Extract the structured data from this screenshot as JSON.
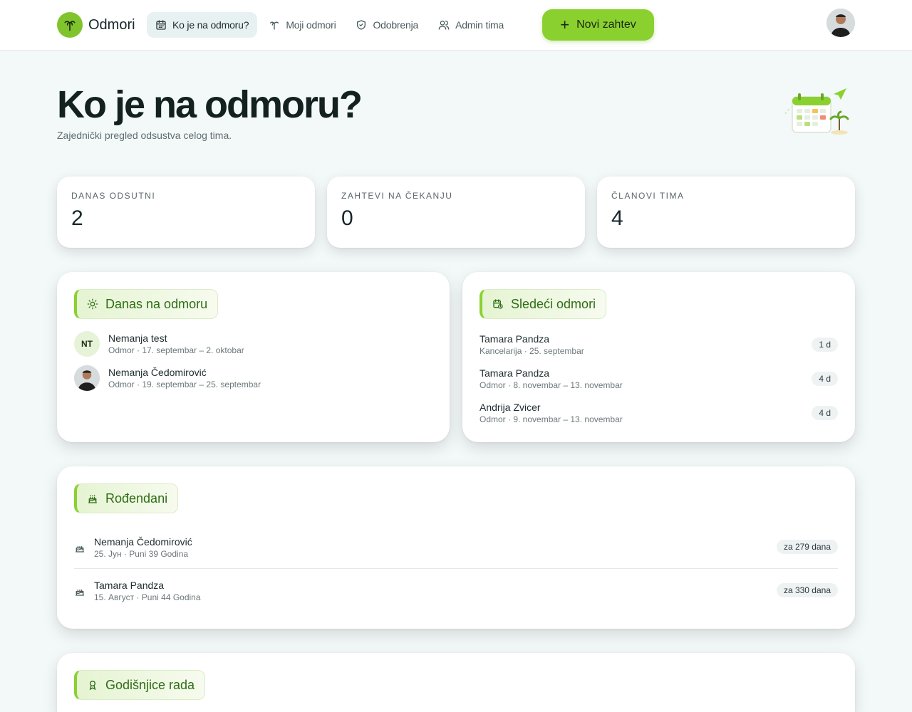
{
  "brand": {
    "name": "Odmori",
    "accent": "#8ad12f"
  },
  "nav": [
    {
      "label": "Ko je na odmoru?",
      "icon": "calendar-icon",
      "active": true
    },
    {
      "label": "Moji odmori",
      "icon": "palm-icon",
      "active": false
    },
    {
      "label": "Odobrenja",
      "icon": "shield-check-icon",
      "active": false
    },
    {
      "label": "Admin tima",
      "icon": "users-icon",
      "active": false
    }
  ],
  "cta": {
    "label": "Novi zahtev",
    "icon": "plus-icon"
  },
  "hero": {
    "title": "Ko je na odmoru?",
    "subtitle": "Zajednički pregled odsustva celog tima."
  },
  "stats": [
    {
      "label": "DANAS ODSUTNI",
      "value": "2"
    },
    {
      "label": "ZAHTEVI NA ČEKANJU",
      "value": "0"
    },
    {
      "label": "ČLANOVI TIMA",
      "value": "4"
    }
  ],
  "today": {
    "title": "Danas na odmoru",
    "icon": "sun-icon",
    "people": [
      {
        "initials": "NT",
        "name": "Nemanja test",
        "detail": "Odmor · 17. septembar – 2. oktobar"
      },
      {
        "initials": "",
        "name": "Nemanja Čedomirović",
        "detail": "Odmor · 19. septembar – 25. septembar"
      }
    ]
  },
  "upcoming": {
    "title": "Sledeći odmori",
    "icon": "calendar-clock-icon",
    "items": [
      {
        "name": "Tamara Pandza",
        "detail": "Kancelarija · 25. septembar",
        "days": "1 d"
      },
      {
        "name": "Tamara Pandza",
        "detail": "Odmor · 8. novembar – 13. novembar",
        "days": "4 d"
      },
      {
        "name": "Andrija Zvicer",
        "detail": "Odmor · 9. novembar – 13. novembar",
        "days": "4 d"
      }
    ]
  },
  "birthdays": {
    "title": "Rođendani",
    "icon": "cake-icon",
    "items": [
      {
        "name": "Nemanja Čedomirović",
        "detail": "25. Јун · Puni 39 Godina",
        "countdown": "za 279 dana"
      },
      {
        "name": "Tamara Pandza",
        "detail": "15. Август · Puni 44 Godina",
        "countdown": "za 330 dana"
      }
    ]
  },
  "anniversaries": {
    "title": "Godišnjice rada",
    "icon": "award-icon"
  }
}
